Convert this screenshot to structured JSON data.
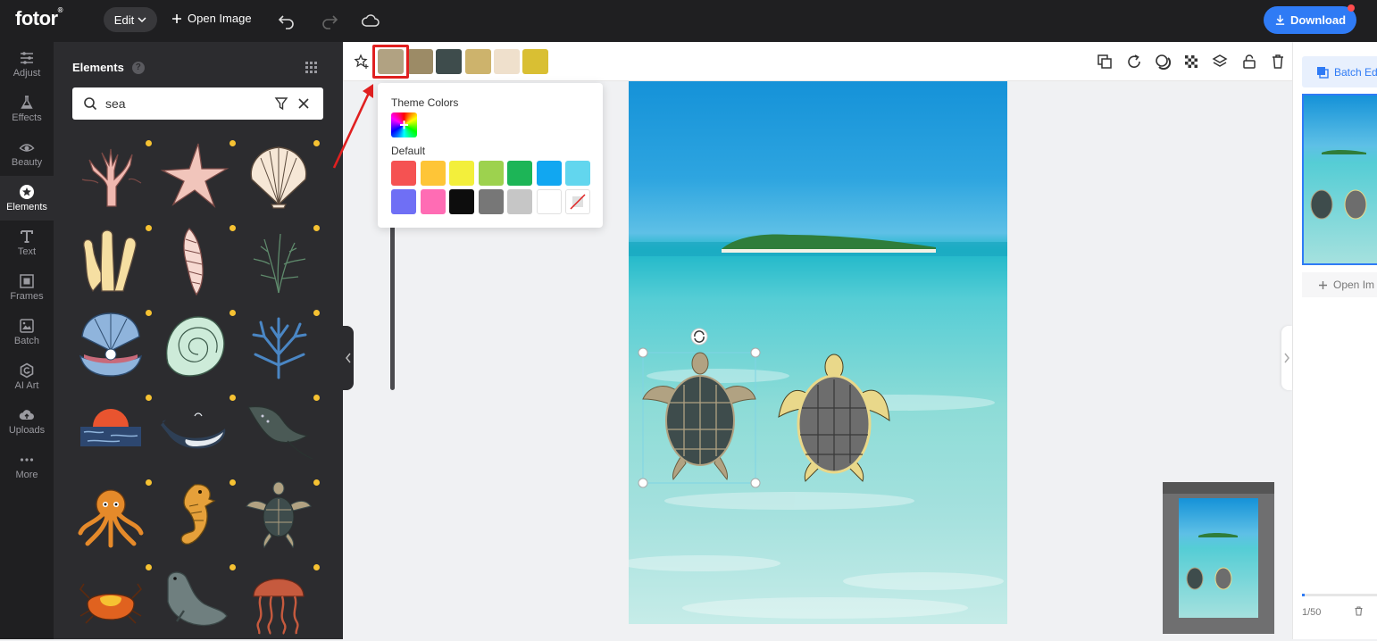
{
  "app": {
    "logo": "fotor",
    "logo_mark": "®",
    "edit_label": "Edit",
    "open_image_label": "Open Image",
    "download_label": "Download"
  },
  "nav": [
    {
      "label": "Adjust",
      "icon": "sliders-icon"
    },
    {
      "label": "Effects",
      "icon": "flask-icon"
    },
    {
      "label": "Beauty",
      "icon": "eye-icon"
    },
    {
      "label": "Elements",
      "icon": "star-circle-icon",
      "active": true
    },
    {
      "label": "Text",
      "icon": "text-t-icon"
    },
    {
      "label": "Frames",
      "icon": "frame-icon"
    },
    {
      "label": "Batch",
      "icon": "batch-icon"
    },
    {
      "label": "AI Art",
      "icon": "ai-art-icon"
    },
    {
      "label": "Uploads",
      "icon": "cloud-upload-icon"
    },
    {
      "label": "More",
      "icon": "more-dots-icon"
    }
  ],
  "panel": {
    "title": "Elements",
    "help": "?",
    "search_value": "sea",
    "elements": [
      "coral",
      "starfish",
      "scallop-shell",
      "sponge-coral",
      "spiral-shell",
      "seaweed",
      "pearl-clam",
      "nautilus-shell",
      "blue-coral",
      "sunset-sea",
      "whale",
      "stingray",
      "octopus",
      "seahorse",
      "sea-turtle",
      "crab",
      "seal",
      "jellyfish"
    ]
  },
  "toolbar": {
    "swatches": [
      "#b1a282",
      "#9c8b66",
      "#3e4c4c",
      "#cdb36c",
      "#efe0cc",
      "#d9bf33"
    ]
  },
  "color_popup": {
    "theme_label": "Theme Colors",
    "default_label": "Default",
    "add": "+",
    "default_colors": [
      "#f55252",
      "#fec537",
      "#f3ef3b",
      "#9dd24e",
      "#1db557",
      "#11a7f1",
      "#62d6ee",
      "#6f6ff5",
      "#ff6cb4",
      "#0d0d0d",
      "#777777",
      "#c6c6c6",
      "#ffffff",
      "none"
    ]
  },
  "right_panel": {
    "batch_label": "Batch Edit",
    "open_label": "Open Im",
    "pager": "1/50"
  },
  "colors": {
    "accent": "#2f7bf5",
    "sidebar_bg": "#1f1f21",
    "panel_bg": "#2c2c2f",
    "premium_dot": "#f6c232",
    "highlight": "#e02020"
  }
}
